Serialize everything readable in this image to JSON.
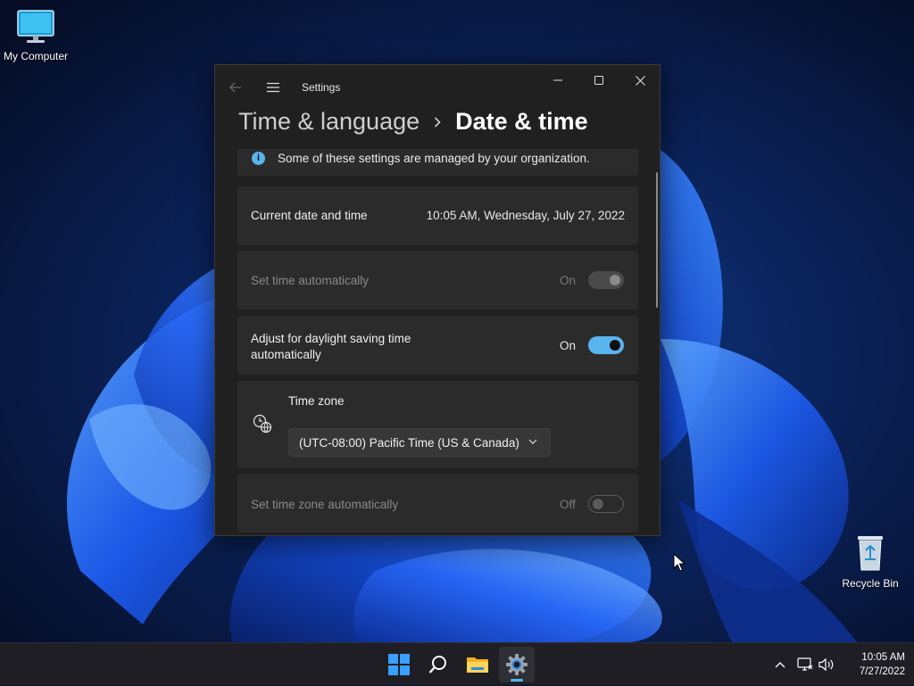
{
  "desktop": {
    "icons": [
      {
        "label": "My Computer",
        "icon": "monitor-icon"
      },
      {
        "label": "Recycle Bin",
        "icon": "recycle-bin-icon"
      }
    ]
  },
  "window": {
    "app_title": "Settings",
    "breadcrumb": {
      "parent": "Time & language",
      "current": "Date & time"
    },
    "banner": {
      "text": "Some of these settings are managed by your organization.",
      "icon": "info-icon"
    },
    "rows": {
      "current": {
        "label": "Current date and time",
        "value": "10:05 AM, Wednesday, July 27, 2022"
      },
      "set_time_auto": {
        "label": "Set time automatically",
        "state": "On",
        "enabled": false
      },
      "dst": {
        "label_line1": "Adjust for daylight saving time",
        "label_line2": "automatically",
        "state": "On",
        "enabled": true
      },
      "time_zone": {
        "label": "Time zone",
        "value": "(UTC-08:00) Pacific Time (US & Canada)",
        "icon": "clock-globe-icon"
      },
      "tz_auto": {
        "label": "Set time zone automatically",
        "state": "Off",
        "enabled": false
      }
    }
  },
  "taskbar": {
    "items": [
      "start-icon",
      "search-icon",
      "file-explorer-icon",
      "settings-icon"
    ],
    "active": "settings-icon",
    "clock": {
      "time": "10:05 AM",
      "date": "7/27/2022"
    }
  },
  "colors": {
    "accent": "#5ab4ee",
    "window_bg": "#202020",
    "card_bg": "#2b2b2b",
    "taskbar_bg": "#1e1e24"
  }
}
